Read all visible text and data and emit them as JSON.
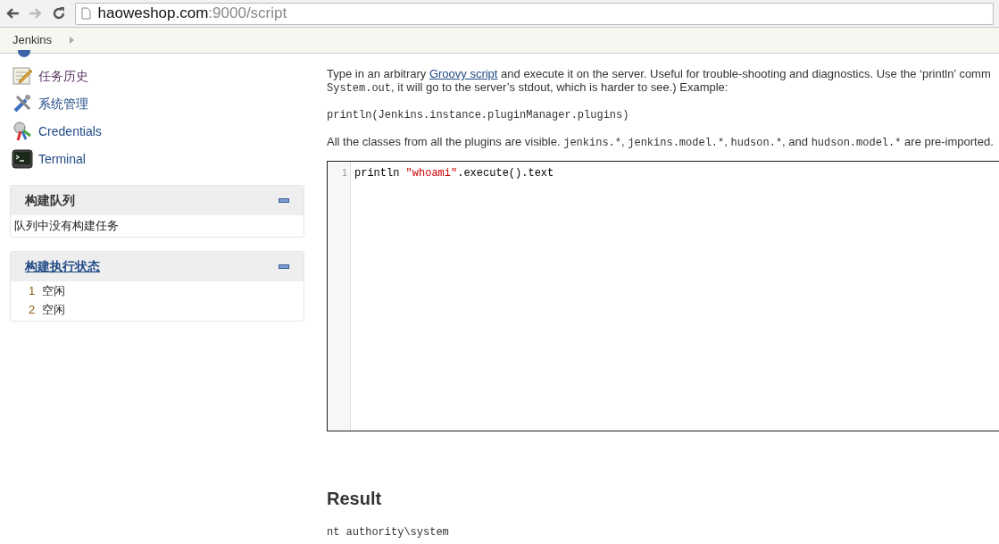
{
  "browser": {
    "url_host": "haoweshop.com",
    "url_path": ":9000/script"
  },
  "breadcrumb": [
    "Jenkins"
  ],
  "tasks": [
    {
      "label": "任务历史",
      "kind": "history",
      "visited": true
    },
    {
      "label": "系统管理",
      "kind": "tools",
      "visited": false
    },
    {
      "label": "Credentials",
      "kind": "keys",
      "visited": false
    },
    {
      "label": "Terminal",
      "kind": "terminal",
      "visited": false
    }
  ],
  "build_queue": {
    "title": "构建队列",
    "empty_text": "队列中没有构建任务"
  },
  "executors": {
    "title": "构建执行状态",
    "rows": [
      {
        "number": "1",
        "status": "空闲"
      },
      {
        "number": "2",
        "status": "空闲"
      }
    ]
  },
  "intro_lines": [
    [
      {
        "kind": "plain",
        "text": "Type in an arbitrary "
      },
      {
        "kind": "link",
        "text": "Groovy script"
      },
      {
        "kind": "plain",
        "text": " and execute it on the server. Useful for trouble-shooting and diagnostics. Use the ‘println’ comm"
      }
    ],
    [
      {
        "kind": "code",
        "text": "System.out"
      },
      {
        "kind": "plain",
        "text": ", it will go to the server’s stdout, which is harder to see.) Example:"
      }
    ]
  ],
  "example": "println(Jenkins.instance.pluginManager.plugins)",
  "imports_note": [
    {
      "kind": "plain",
      "text": "All the classes from all the plugins are visible. "
    },
    {
      "kind": "code",
      "text": "jenkins.*"
    },
    {
      "kind": "plain",
      "text": ", "
    },
    {
      "kind": "code",
      "text": "jenkins.model.*"
    },
    {
      "kind": "plain",
      "text": ", "
    },
    {
      "kind": "code",
      "text": "hudson.*"
    },
    {
      "kind": "plain",
      "text": ", and "
    },
    {
      "kind": "code",
      "text": "hudson.model.*"
    },
    {
      "kind": "plain",
      "text": " are pre-imported."
    }
  ],
  "editor": {
    "lines": [
      {
        "number": "1",
        "tokens": [
          {
            "kind": "plain",
            "text": "println "
          },
          {
            "kind": "string",
            "text": "\"whoami\""
          },
          {
            "kind": "plain",
            "text": ".execute().text"
          }
        ]
      }
    ]
  },
  "result": {
    "title": "Result",
    "output": "nt authority\\system"
  }
}
